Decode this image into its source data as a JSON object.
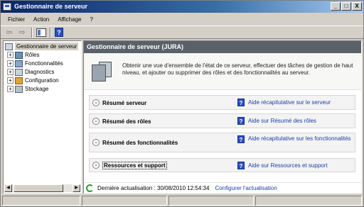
{
  "window": {
    "title": "Gestionnaire de serveur",
    "minimize": "_",
    "maximize": "□",
    "close": "X"
  },
  "menu": {
    "items": [
      "Fichier",
      "Action",
      "Affichage",
      "?"
    ]
  },
  "toolbar": {
    "back": "⇦",
    "forward": "⇨",
    "help": "?"
  },
  "tree": {
    "root": "Gestionnaire de serveur",
    "items": [
      {
        "label": "Rôles",
        "icon": "roles-icon"
      },
      {
        "label": "Fonctionnalités",
        "icon": "features-icon"
      },
      {
        "label": "Diagnostics",
        "icon": "diagnostics-icon"
      },
      {
        "label": "Configuration",
        "icon": "configuration-icon"
      },
      {
        "label": "Stockage",
        "icon": "storage-icon"
      }
    ],
    "expander": "+"
  },
  "content": {
    "header": "Gestionnaire de serveur (JURA)",
    "intro": "Obtenir une vue d'ensemble de l'état de ce serveur, effectuer des tâches de gestion de haut niveau, et ajouter ou supprimer des rôles et des fonctionnalités au serveur.",
    "sections": [
      {
        "title": "Résumé serveur",
        "help": "Aide récapitulative sur le serveur"
      },
      {
        "title": "Résumé des rôles",
        "help": "Aide sur Résumé des rôles"
      },
      {
        "title": "Résumé des fonctionnalités",
        "help": "Aide récapitulative sur les fonctionnalités"
      },
      {
        "title": "Ressources et support",
        "help": "Aide sur Ressources et support"
      }
    ],
    "help_icon": "?",
    "chevron": "⌄",
    "refresh": {
      "text": "Dernière actualisation : 30/08/2010 12:54:34",
      "link": "Configurer l'actualisation"
    }
  },
  "scroll": {
    "left": "◀",
    "right": "▶"
  }
}
